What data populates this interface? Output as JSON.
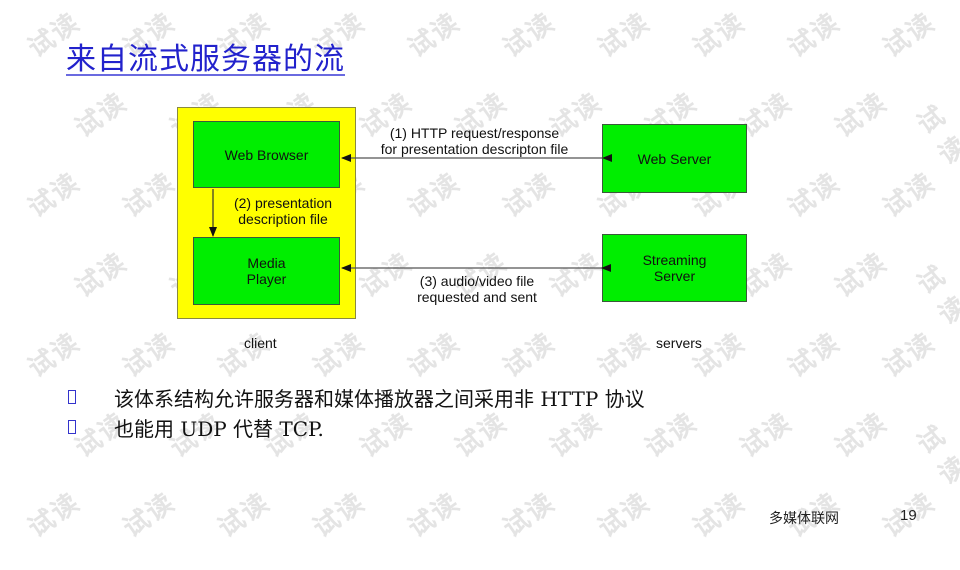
{
  "slide": {
    "title": "来自流式服务器的流",
    "watermark_text": "试读",
    "colors": {
      "title": "#2222cc",
      "client_container": "#ffff00",
      "node_fill": "#00ee00",
      "bullet": "#3333cc"
    }
  },
  "diagram": {
    "nodes": {
      "web_browser": "Web Browser",
      "media_player_line1": "Media",
      "media_player_line2": "Player",
      "web_server": "Web Server",
      "streaming_server_line1": "Streaming",
      "streaming_server_line2": "Server"
    },
    "edges": {
      "http_line1": "(1) HTTP request/response",
      "http_line2": "for presentation descripton file",
      "presentation_line1": "(2)  presentation",
      "presentation_line2": "description file",
      "av_line1": "(3) audio/video file",
      "av_line2": "requested and sent"
    },
    "groups": {
      "client": "client",
      "servers": "servers"
    }
  },
  "bullets": [
    "该体系结构允许服务器和媒体播放器之间采用非 HTTP  协议",
    "也能用 UDP 代替 TCP."
  ],
  "footer": {
    "source": "多媒体联网",
    "page_number": "19"
  }
}
